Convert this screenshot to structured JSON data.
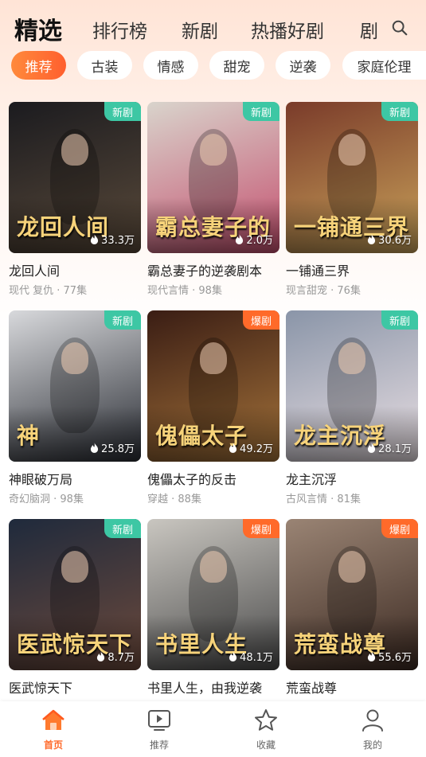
{
  "header": {
    "tabs": [
      {
        "label": "精选",
        "active": true
      },
      {
        "label": "排行榜"
      },
      {
        "label": "新剧"
      },
      {
        "label": "热播好剧"
      },
      {
        "label": "剧"
      }
    ],
    "search_icon": "search-icon"
  },
  "categories": [
    {
      "label": "推荐",
      "active": true
    },
    {
      "label": "古装"
    },
    {
      "label": "情感"
    },
    {
      "label": "甜宠"
    },
    {
      "label": "逆袭"
    },
    {
      "label": "家庭伦理"
    }
  ],
  "dramas": [
    {
      "title": "龙回人间",
      "poster_text": "龙回人间",
      "meta": "现代 复仇 · 77集",
      "heat": "33.3万",
      "badge": "新剧",
      "badge_type": "new",
      "colors": [
        "#1b1b1f",
        "#5a4a3a"
      ]
    },
    {
      "title": "霸总妻子的逆袭剧本",
      "poster_text": "霸总妻子的",
      "meta": "现代言情 · 98集",
      "heat": "2.0万",
      "badge": "新剧",
      "badge_type": "new",
      "colors": [
        "#d9d4cc",
        "#c44f6e"
      ]
    },
    {
      "title": "一铺通三界",
      "poster_text": "一铺通三界",
      "meta": "现言甜宠 · 76集",
      "heat": "30.6万",
      "badge": "新剧",
      "badge_type": "new",
      "colors": [
        "#7a3b2a",
        "#c9a25a"
      ]
    },
    {
      "title": "神眼破万局",
      "poster_text": "神",
      "meta": "奇幻脑洞 · 98集",
      "heat": "25.8万",
      "badge": "新剧",
      "badge_type": "new",
      "colors": [
        "#d8d9dc",
        "#2a2d34"
      ]
    },
    {
      "title": "傀儡太子的反击",
      "poster_text": "傀儡太子",
      "meta": "穿越 · 88集",
      "heat": "49.2万",
      "badge": "爆剧",
      "badge_type": "hot",
      "colors": [
        "#3a1d14",
        "#a5733a"
      ]
    },
    {
      "title": "龙主沉浮",
      "poster_text": "龙主沉浮",
      "meta": "古风言情 · 81集",
      "heat": "28.1万",
      "badge": "新剧",
      "badge_type": "new",
      "colors": [
        "#8a95a8",
        "#e9dfe3"
      ]
    },
    {
      "title": "医武惊天下",
      "poster_text": "医武惊天下",
      "meta": "",
      "heat": "8.7万",
      "badge": "新剧",
      "badge_type": "new",
      "colors": [
        "#1f2a3c",
        "#6d4a3c"
      ]
    },
    {
      "title": "书里人生，由我逆袭",
      "poster_text": "书里人生",
      "meta": "",
      "heat": "48.1万",
      "badge": "爆剧",
      "badge_type": "hot",
      "colors": [
        "#c9c6c0",
        "#4a4a4a"
      ]
    },
    {
      "title": "荒蛮战尊",
      "poster_text": "荒蛮战尊",
      "meta": "",
      "heat": "55.6万",
      "badge": "爆剧",
      "badge_type": "hot",
      "colors": [
        "#9a8474",
        "#3c2a22"
      ]
    }
  ],
  "bottom_nav": [
    {
      "label": "首页",
      "icon": "home-icon",
      "active": true
    },
    {
      "label": "推荐",
      "icon": "play-screen-icon"
    },
    {
      "label": "收藏",
      "icon": "star-icon"
    },
    {
      "label": "我的",
      "icon": "user-icon"
    }
  ],
  "accent": "#ff6a2a"
}
